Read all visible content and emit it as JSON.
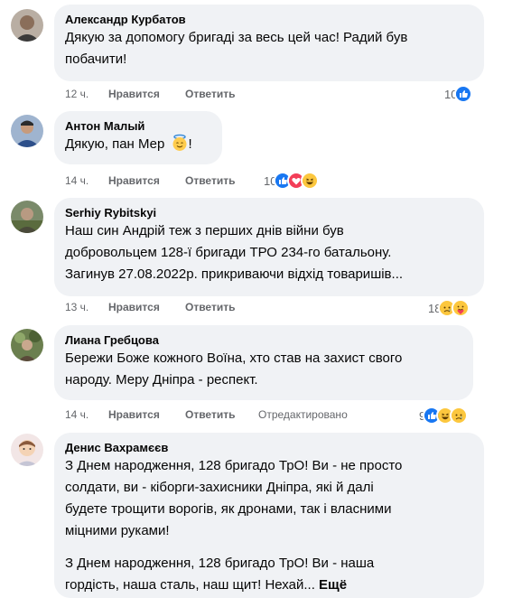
{
  "actions": {
    "like": "Нравится",
    "reply": "Ответить"
  },
  "comments": [
    {
      "author": "Александр Курбатов",
      "lines": [
        "Дякую за допомогу бригаді за весь цей час! Радий був",
        "побачити!"
      ],
      "time": "12 ч.",
      "reaction_count": "10",
      "reaction_icons": [
        "like-icon"
      ]
    },
    {
      "author": "Антон Малый",
      "lines": [
        "Дякую, пан Мер"
      ],
      "emoji": "halo-face-emoji",
      "emoji_suffix": "!",
      "time": "14 ч.",
      "reaction_count": "10",
      "reaction_icons": [
        "like-icon",
        "love-icon",
        "haha-icon"
      ]
    },
    {
      "author": "Serhiy Rybitskyi",
      "lines": [
        "Наш син Андрій теж з перших днів війни був",
        "добровольцем 128-ї бригади ТРО 234-го батальону.",
        "Загинув 27.08.2022р. прикриваючи відхід товаришів..."
      ],
      "time": "13 ч.",
      "reaction_count": "18",
      "reaction_icons": [
        "sad-icon",
        "care-icon"
      ]
    },
    {
      "author": "Лиана Гребцова",
      "lines": [
        "Бережи Боже кожного Воїна, хто став на захист свого",
        "народу. Меру Дніпра - респект."
      ],
      "time": "14 ч.",
      "edited": "Отредактировано",
      "reaction_count": "9",
      "reaction_icons": [
        "like-icon",
        "haha-icon",
        "sad-icon"
      ]
    },
    {
      "author": "Денис Вахрамєєв",
      "lines": [
        "З Днем народження, 128 бригадо ТрО! Ви - не просто",
        "солдати, ви - кіборги-захисники Дніпра, які й далі",
        "будете трощити ворогів, як дронами, так і власними",
        "міцними руками!",
        "",
        "З Днем народження, 128 бригадо ТрО! Ви - наша",
        "гордість, наша сталь, наш щит! Нехай..."
      ],
      "more": "Ещё"
    }
  ]
}
